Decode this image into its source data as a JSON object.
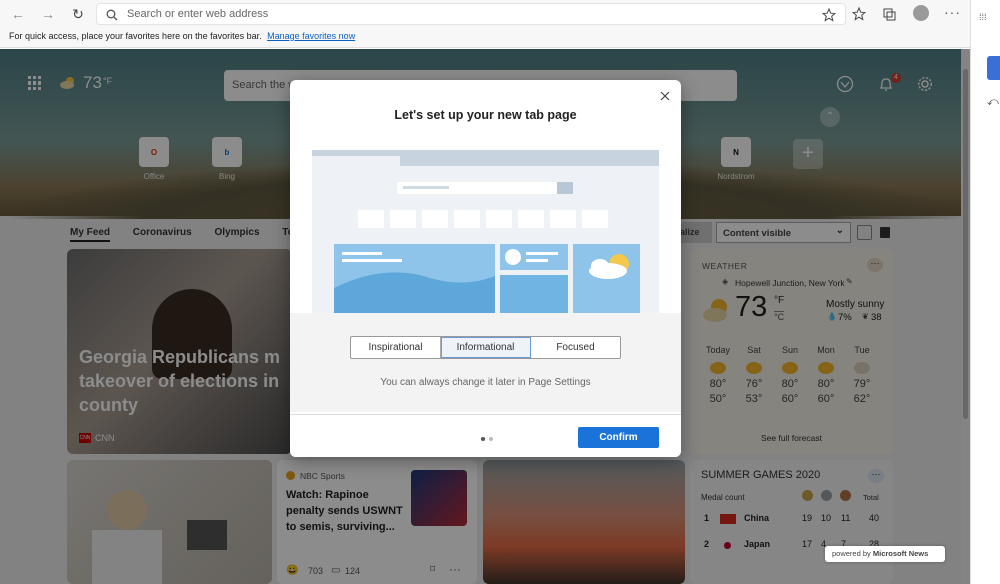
{
  "browser": {
    "address_placeholder": "Search or enter web address",
    "favorites_hint": "For quick access, place your favorites here on the favorites bar.",
    "favorites_link": "Manage favorites now"
  },
  "header": {
    "temperature": "73",
    "temp_unit": "°F",
    "search_placeholder": "Search the w",
    "notification_count": "4"
  },
  "quick_links": [
    {
      "label": "Office",
      "glyph": "O"
    },
    {
      "label": "Bing",
      "glyph": "b"
    },
    {
      "label": "Nordstrom",
      "glyph": "N"
    }
  ],
  "feed": {
    "tabs": [
      "My Feed",
      "Coronavirus",
      "Olympics",
      "Top"
    ],
    "personalize_suffix": "alize",
    "content_select": "Content visible"
  },
  "main_card": {
    "headline": "Georgia Republicans m takeover of elections in county",
    "source": "CNN"
  },
  "sports_card": {
    "source": "NBC Sports",
    "headline": "Watch: Rapinoe penalty sends USWNT to semis, surviving...",
    "reactions": "703",
    "comments": "124"
  },
  "weather": {
    "title": "WEATHER",
    "location": "Hopewell Junction, New York",
    "temp": "73",
    "unit_f": "°F",
    "unit_c": "°C",
    "condition": "Mostly sunny",
    "precip": "7%",
    "aqi": "38",
    "days": [
      {
        "name": "Today",
        "high": "80°",
        "low": "50°"
      },
      {
        "name": "Sat",
        "high": "76°",
        "low": "53°"
      },
      {
        "name": "Sun",
        "high": "80°",
        "low": "60°"
      },
      {
        "name": "Mon",
        "high": "80°",
        "low": "60°"
      },
      {
        "name": "Tue",
        "high": "79°",
        "low": "62°"
      }
    ],
    "forecast_link": "See full forecast"
  },
  "games": {
    "title": "SUMMER GAMES 2020",
    "medal_count": "Medal count",
    "total": "Total",
    "rows": [
      {
        "rank": "1",
        "country": "China",
        "gold": "19",
        "silver": "10",
        "bronze": "11",
        "total": "40"
      },
      {
        "rank": "2",
        "country": "Japan",
        "gold": "17",
        "silver": "4",
        "bronze": "7",
        "total": "28"
      }
    ],
    "powered_by": "powered by",
    "powered_brand": "Microsoft News"
  },
  "modal": {
    "title": "Let's set up your new tab page",
    "options": [
      "Inspirational",
      "Informational",
      "Focused"
    ],
    "hint": "You can always change it later in Page Settings",
    "confirm": "Confirm"
  }
}
